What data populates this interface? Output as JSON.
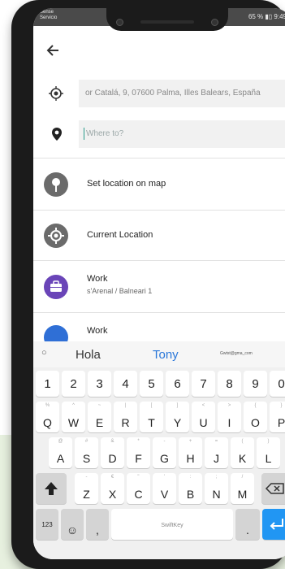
{
  "status_bar": {
    "carrier": "Sense\nServicio",
    "right": "65 % ▮▯ 9:49"
  },
  "search": {
    "from_value": "or Catalá, 9, 07600 Palma, Illes Balears, España",
    "to_placeholder": "Where to?"
  },
  "list": [
    {
      "label": "Set location on map",
      "sub": "",
      "icon": "pin-icon",
      "color": "#6b6b6b"
    },
    {
      "label": "Current Location",
      "sub": "",
      "icon": "target-icon",
      "color": "#6b6b6b"
    },
    {
      "label": "Work",
      "sub": "s'Arenal / Balneari 1",
      "icon": "briefcase-icon",
      "color": "#6a45b8"
    },
    {
      "label": "Work",
      "sub": "",
      "icon": "briefcase-icon",
      "color": "#2f6fd6"
    }
  ],
  "keyboard": {
    "suggestions": [
      "Hola",
      "Tony",
      "Gwtst@gma_com"
    ],
    "suggest_icon": "○",
    "num_row": [
      "1",
      "2",
      "3",
      "4",
      "5",
      "6",
      "7",
      "8",
      "9",
      "0"
    ],
    "row1": [
      "Q",
      "W",
      "E",
      "R",
      "T",
      "Y",
      "U",
      "I",
      "O",
      "P"
    ],
    "row1_hints": [
      "%",
      "^",
      "~",
      "|",
      "[",
      "]",
      "<",
      ">",
      "{",
      "}"
    ],
    "row2": [
      "A",
      "S",
      "D",
      "F",
      "G",
      "H",
      "J",
      "K",
      "L"
    ],
    "row2_hints": [
      "@",
      "#",
      "&",
      "*",
      "-",
      "+",
      "=",
      "(",
      ")"
    ],
    "row3": [
      "Z",
      "X",
      "C",
      "V",
      "B",
      "N",
      "M"
    ],
    "row3_hints": [
      "-",
      "€",
      "\"",
      "'",
      ":",
      ";",
      "/"
    ],
    "bottom": {
      "sym": "123",
      "emoji": "☺",
      "comma": ",",
      "space": "SwiftKey",
      "period": "."
    }
  },
  "colors": {
    "accent": "#2a9c8c",
    "work_purple": "#6a45b8",
    "enter_blue": "#2196f3",
    "suggest_blue": "#2a77d9"
  }
}
